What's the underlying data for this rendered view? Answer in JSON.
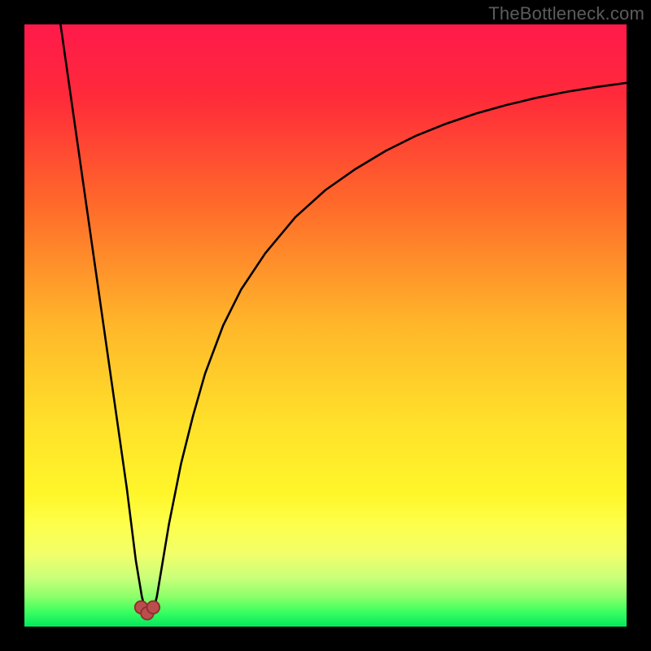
{
  "watermark": "TheBottleneck.com",
  "colors": {
    "frame": "#000000",
    "curve": "#000000",
    "marker_fill": "#bb4d4d",
    "marker_stroke": "#8f2f2f",
    "gradient_stops": [
      {
        "offset": "0%",
        "color": "#ff1a4b"
      },
      {
        "offset": "12%",
        "color": "#ff2a3a"
      },
      {
        "offset": "30%",
        "color": "#ff6a2a"
      },
      {
        "offset": "50%",
        "color": "#ffb72a"
      },
      {
        "offset": "66%",
        "color": "#ffe02a"
      },
      {
        "offset": "78%",
        "color": "#fff62a"
      },
      {
        "offset": "83%",
        "color": "#fdff4a"
      },
      {
        "offset": "88%",
        "color": "#f1ff6a"
      },
      {
        "offset": "92%",
        "color": "#c8ff7a"
      },
      {
        "offset": "95%",
        "color": "#8cff6a"
      },
      {
        "offset": "97.5%",
        "color": "#3dff60"
      },
      {
        "offset": "100%",
        "color": "#00e85e"
      }
    ]
  },
  "chart_data": {
    "type": "line",
    "title": "",
    "xlabel": "",
    "ylabel": "",
    "xlim": [
      0,
      100
    ],
    "ylim": [
      0,
      100
    ],
    "grid": false,
    "series": [
      {
        "name": "bottleneck-curve",
        "x": [
          6,
          7,
          8,
          9,
          10,
          11,
          12,
          13,
          14,
          15,
          16,
          17,
          17.5,
          18,
          18.5,
          19,
          19.5,
          20,
          20.5,
          21,
          21.5,
          22,
          22.5,
          23,
          24,
          26,
          28,
          30,
          33,
          36,
          40,
          45,
          50,
          55,
          60,
          65,
          70,
          75,
          80,
          85,
          90,
          95,
          100
        ],
        "y": [
          100,
          93,
          86,
          79,
          72,
          65,
          58,
          51,
          44,
          37,
          30,
          23,
          19,
          15,
          11,
          8,
          5,
          3,
          2,
          2,
          3,
          5,
          8,
          11,
          17,
          27,
          35,
          42,
          50,
          56,
          62,
          68,
          72.5,
          76,
          79,
          81.5,
          83.5,
          85.2,
          86.6,
          87.8,
          88.8,
          89.6,
          90.3
        ]
      }
    ],
    "markers": [
      {
        "name": "min-left",
        "x": 19.4,
        "y": 3.2
      },
      {
        "name": "min-center",
        "x": 20.4,
        "y": 2.2
      },
      {
        "name": "min-right",
        "x": 21.4,
        "y": 3.2
      }
    ],
    "legend": false
  }
}
